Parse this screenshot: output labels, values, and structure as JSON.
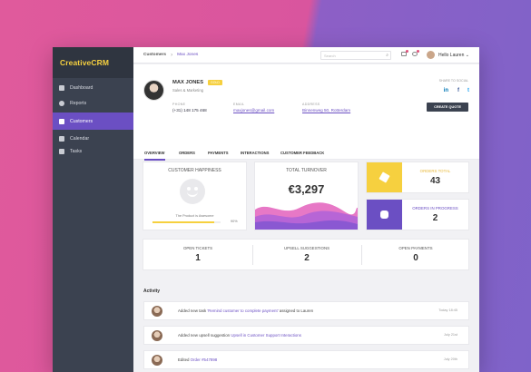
{
  "app": {
    "logo": "CreativeCRM"
  },
  "sidebar": {
    "items": [
      {
        "label": "Dashboard",
        "icon": "dashboard-icon"
      },
      {
        "label": "Reports",
        "icon": "clock-icon"
      },
      {
        "label": "Customers",
        "icon": "customers-icon",
        "active": true
      },
      {
        "label": "Calendar",
        "icon": "calendar-icon"
      },
      {
        "label": "Tasks",
        "icon": "tasks-icon"
      }
    ]
  },
  "topbar": {
    "breadcrumb": [
      "Customers",
      "Max Jones"
    ],
    "search_placeholder": "Search",
    "user_name": "Hello Lauren"
  },
  "profile": {
    "name": "MAX JONES",
    "badge": "GOLD",
    "role": "Sales & Marketing",
    "phone_label": "PHONE",
    "phone": "(+31) 148 175 468",
    "email_label": "EMAIL",
    "email": "maxjones@gmail.com",
    "address_label": "ADDRESS",
    "address": "Binnenweg 50, Rotterdam",
    "share_label": "SHARE TO SOCIAL",
    "create_button": "CREATE QUOTE"
  },
  "tabs": [
    "OVERVIEW",
    "ORDERS",
    "PAYMENTS",
    "INTERACTIONS",
    "CUSTOMER FEEDBACK"
  ],
  "cards": {
    "happiness_title": "CUSTOMER HAPPINESS",
    "happiness_text": "The Product is Awesome",
    "happiness_pct": "90%",
    "happiness_value": 0.9,
    "turnover_title": "TOTAL TURNOVER",
    "turnover_value": "€3,297",
    "orders_total_label": "ORDERS TOTAL",
    "orders_total_value": "43",
    "orders_progress_label": "ORDERS IN PROGRESS",
    "orders_progress_value": "2"
  },
  "stats_row": [
    {
      "label": "OPEN TICKETS",
      "value": "1"
    },
    {
      "label": "UPSELL SUGGESTIONS",
      "value": "2"
    },
    {
      "label": "OPEN PAYMENTS",
      "value": "0"
    }
  ],
  "activity": {
    "title": "Activity",
    "items": [
      {
        "prefix": "Added new task ",
        "highlight": "'Remind customer to complete payment'",
        "suffix": " assigned to Lauren",
        "date": "Today 18:45"
      },
      {
        "prefix": "Added new upsell suggestion ",
        "highlight": "Upsell in Customer Support Interactions",
        "suffix": "",
        "date": "July 21st"
      },
      {
        "prefix": "Edited ",
        "highlight": "Order #547898",
        "suffix": "",
        "date": "July 20th"
      }
    ]
  },
  "colors": {
    "accent": "#6b4fc3",
    "gold": "#f6d03f",
    "sidebar": "#3b4250"
  }
}
